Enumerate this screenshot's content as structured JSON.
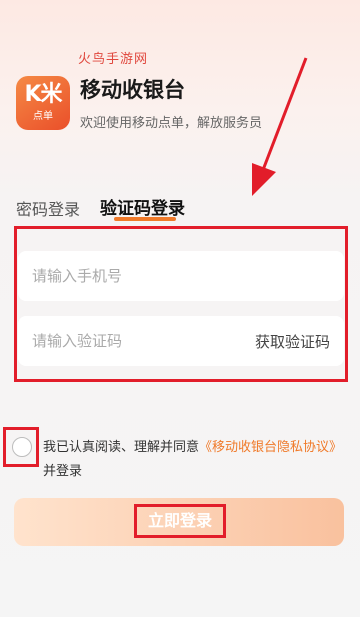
{
  "watermark": "火鸟手游网",
  "brand": {
    "logo_top": "K米",
    "logo_bottom": "点单",
    "title": "移动收银台",
    "subtitle": "欢迎使用移动点单，解放服务员"
  },
  "tabs": {
    "password": "密码登录",
    "sms": "验证码登录",
    "active": "sms"
  },
  "form": {
    "phone_placeholder": "请输入手机号",
    "phone_value": "",
    "code_placeholder": "请输入验证码",
    "code_value": "",
    "get_code_label": "获取验证码"
  },
  "agreement": {
    "prefix": "我已认真阅读、理解并同意",
    "link": "《移动收银台隐私协议》",
    "suffix": "并登录",
    "checked": false
  },
  "login_button": "立即登录",
  "colors": {
    "accent": "#f07a2a",
    "annotation": "#e21d2a"
  }
}
